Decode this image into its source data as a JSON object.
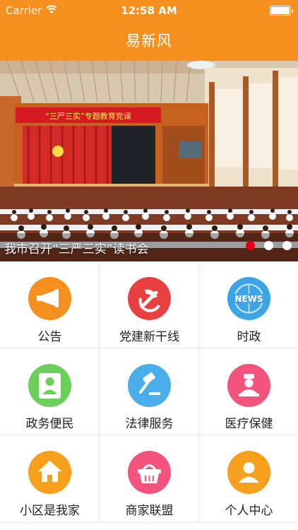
{
  "status_bar": {
    "carrier": "Carrier",
    "time": "12:58 AM",
    "battery_level": 1.0
  },
  "nav": {
    "title": "易新风"
  },
  "banner": {
    "hall_banner_text": "“三严三实”专题教育党课",
    "caption": "我市召开“三严三实”读书会",
    "active_dot": 0
  },
  "colors": {
    "brand_orange": "#f5901e",
    "active_dot": "#e50012"
  },
  "grid": {
    "items": [
      {
        "label": "公告",
        "icon": "megaphone-icon",
        "color": "#f5901e"
      },
      {
        "label": "党建新干线",
        "icon": "party-emblem-icon",
        "color": "#e84040"
      },
      {
        "label": "时政",
        "icon": "news-icon",
        "color": "#3da5e6"
      },
      {
        "label": "政务便民",
        "icon": "official-person-icon",
        "color": "#6dcf5b"
      },
      {
        "label": "法律服务",
        "icon": "gavel-icon",
        "color": "#4aaeea"
      },
      {
        "label": "医疗保健",
        "icon": "nurse-icon",
        "color": "#f2547e"
      },
      {
        "label": "小区是我家",
        "icon": "home-icon",
        "color": "#f7a01e"
      },
      {
        "label": "商家联盟",
        "icon": "shopping-basket-icon",
        "color": "#f2547e"
      },
      {
        "label": "个人中心",
        "icon": "user-icon",
        "color": "#f7a01e"
      }
    ]
  }
}
